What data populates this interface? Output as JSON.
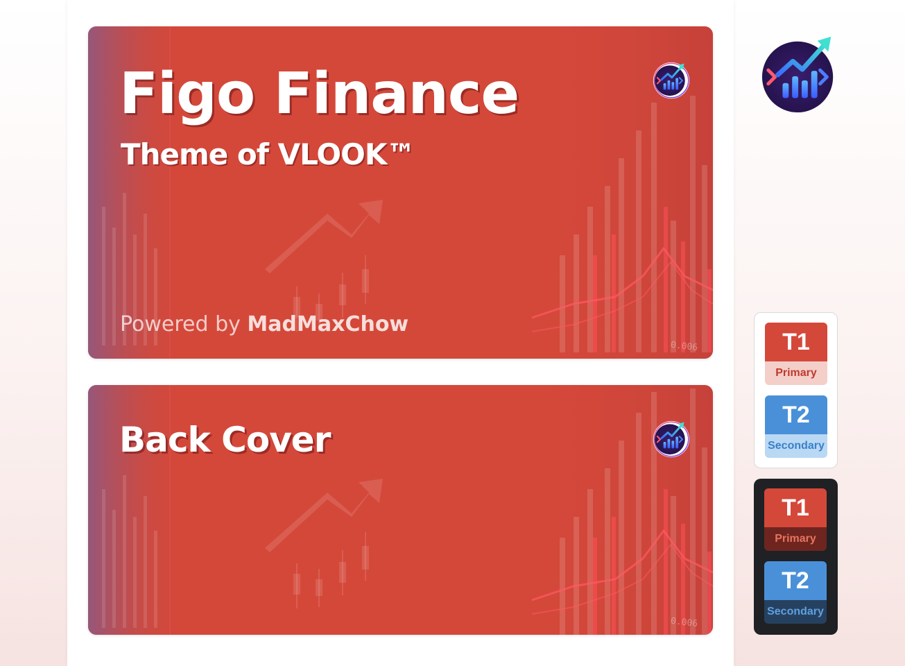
{
  "cover": {
    "title": "Figo Finance",
    "subtitle": "Theme of VLOOK™",
    "powered_prefix": "Powered by ",
    "powered_author": "MadMaxChow",
    "chart_label": "0.006"
  },
  "back_cover": {
    "title": "Back Cover",
    "chart_label": "0.006"
  },
  "logo_icon": "finance-growth-chart-logo",
  "theme_light": {
    "primary": {
      "code": "T1",
      "label": "Primary"
    },
    "secondary": {
      "code": "T2",
      "label": "Secondary"
    }
  },
  "theme_dark": {
    "primary": {
      "code": "T1",
      "label": "Primary"
    },
    "secondary": {
      "code": "T2",
      "label": "Secondary"
    }
  },
  "colors": {
    "primary": "#d4483a",
    "secondary": "#4a90d9",
    "dark_panel": "#1f2124"
  }
}
